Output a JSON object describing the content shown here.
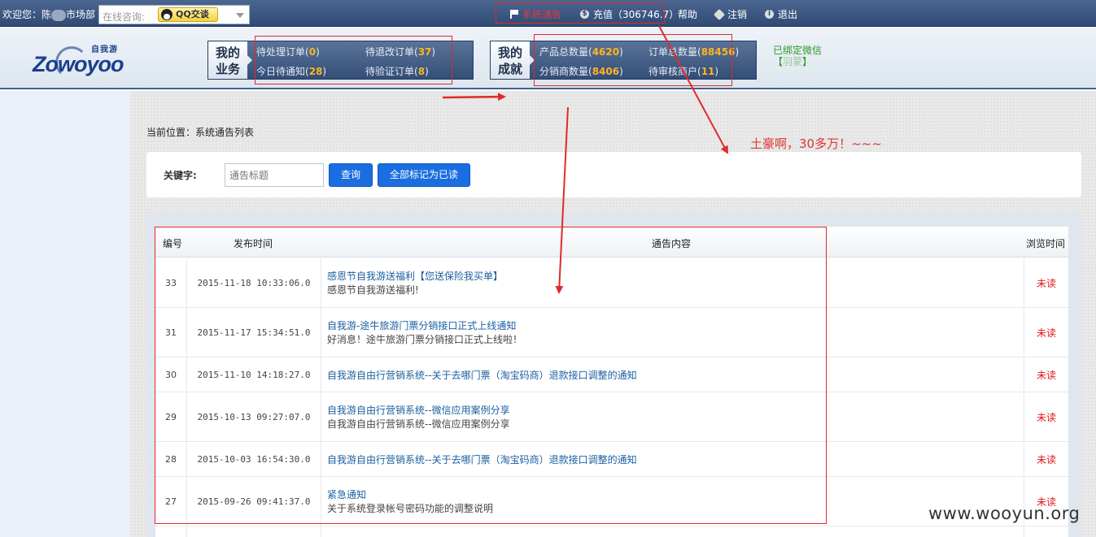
{
  "topbar": {
    "welcome_prefix": "欢迎您：陈",
    "welcome_suffix": "市场部",
    "consult_label": "在线咨询:",
    "qq_label": "QQ交谈",
    "nav": [
      {
        "label": "系统通告",
        "icon": "flag-icon"
      },
      {
        "label": "充值（306746.7）",
        "icon": "dollar-icon"
      },
      {
        "label": "帮助",
        "icon": ""
      },
      {
        "label": "注销",
        "icon": "tag-icon"
      },
      {
        "label": "退出",
        "icon": "info-icon"
      }
    ]
  },
  "logo": {
    "small": "自我游",
    "big": "Zowoyoo"
  },
  "business_panel": {
    "title_line1": "我的",
    "title_line2": "业务",
    "items": [
      {
        "label": "待处理订单",
        "count": "0"
      },
      {
        "label": "待退改订单",
        "count": "37"
      },
      {
        "label": "今日待通知",
        "count": "28"
      },
      {
        "label": "待验证订单",
        "count": "8"
      }
    ]
  },
  "achievement_panel": {
    "title_line1": "我的",
    "title_line2": "成就",
    "items": [
      {
        "label": "产品总数量",
        "count": "4620"
      },
      {
        "label": "订单总数量",
        "count": "88456"
      },
      {
        "label": "分销商数量",
        "count": "8406"
      },
      {
        "label": "待审核商户",
        "count": "11"
      }
    ]
  },
  "wechat": {
    "status": "已绑定微信",
    "name_prefix": "【",
    "name": "羽蒙",
    "name_suffix": "】"
  },
  "breadcrumb": "当前位置：系统通告列表",
  "search": {
    "keyword_label": "关键字:",
    "placeholder": "通告标题",
    "query_button": "查询",
    "mark_all_button": "全部标记为已读"
  },
  "table": {
    "headers": [
      "编号",
      "发布时间",
      "通告内容",
      "浏览时间"
    ],
    "rows": [
      {
        "id": "33",
        "time": "2015-11-18 10:33:06.0",
        "title": "感恩节自我游送福利【您送保险我买单】",
        "summary": "感恩节自我游送福利!",
        "status": "未读"
      },
      {
        "id": "31",
        "time": "2015-11-17 15:34:51.0",
        "title": "自我游-途牛旅游门票分销接口正式上线通知",
        "summary": "好消息！途牛旅游门票分销接口正式上线啦！",
        "status": "未读"
      },
      {
        "id": "30",
        "time": "2015-11-10 14:18:27.0",
        "title": "自我游自由行营销系统--关于去哪门票（淘宝码商）退款接口调整的通知",
        "summary": "",
        "status": "未读"
      },
      {
        "id": "29",
        "time": "2015-10-13 09:27:07.0",
        "title": "自我游自由行营销系统--微信应用案例分享",
        "summary": "自我游自由行营销系统--微信应用案例分享",
        "status": "未读"
      },
      {
        "id": "28",
        "time": "2015-10-03 16:54:30.0",
        "title": "自我游自由行营销系统--关于去哪门票（淘宝码商）退款接口调整的通知",
        "summary": "",
        "status": "未读"
      },
      {
        "id": "27",
        "time": "2015-09-26 09:41:37.0",
        "title": "紧急通知",
        "summary": "关于系统登录帐号密码功能的调整说明",
        "status": "未读"
      }
    ]
  },
  "annotation": "土豪啊，30多万！~~~",
  "watermark": "www.wooyun.org",
  "colors": {
    "topbar": "#2f4a75",
    "accent_red": "#e02a2a",
    "link_blue": "#1a5fa0",
    "button_blue": "#1a6ee0",
    "count_orange": "#ffb520"
  }
}
